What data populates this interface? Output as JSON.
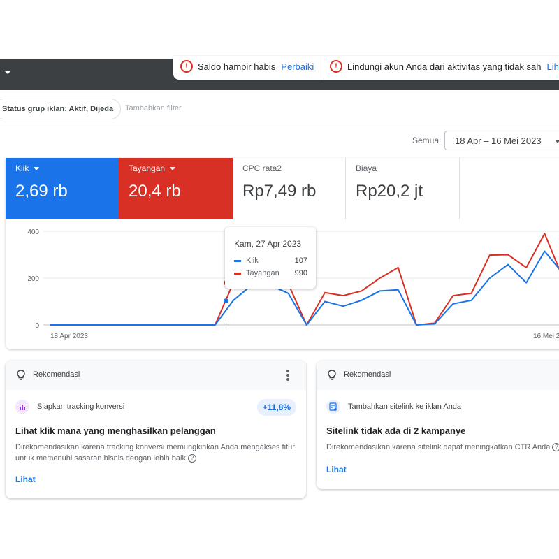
{
  "alerts": [
    {
      "text": "Saldo hampir habis",
      "link": "Perbaiki"
    },
    {
      "text": "Lindungi akun Anda dari aktivitas yang tidak sah",
      "link": "Lih"
    }
  ],
  "filters": {
    "chip": "Status grup iklan: Aktif, Dijeda",
    "add_filter": "Tambahkan filter"
  },
  "date": {
    "prefix": "Semua",
    "range": "18 Apr – 16 Mei 2023"
  },
  "metrics": [
    {
      "label": "Klik",
      "value": "2,69 rb",
      "color": "#1a73e8"
    },
    {
      "label": "Tayangan",
      "value": "20,4 rb",
      "color": "#d93025"
    },
    {
      "label": "CPC rata2",
      "value": "Rp7,49 rb"
    },
    {
      "label": "Biaya",
      "value": "Rp20,2 jt"
    }
  ],
  "tooltip": {
    "title": "Kam, 27 Apr 2023",
    "rows": [
      {
        "name": "Klik",
        "value": "107",
        "color": "#1a73e8"
      },
      {
        "name": "Tayangan",
        "value": "990",
        "color": "#d93025"
      }
    ]
  },
  "chart_data": {
    "type": "line",
    "x_labels": [
      "18 Apr 2023",
      "16 Mei 2023"
    ],
    "yticks": [
      0,
      200,
      400
    ],
    "ylim": [
      0,
      400
    ],
    "grid": true,
    "series": [
      {
        "name": "Klik",
        "color": "#1a73e8",
        "values": [
          0,
          0,
          0,
          0,
          0,
          0,
          0,
          0,
          0,
          0,
          105,
          170,
          170,
          135,
          0,
          100,
          80,
          105,
          145,
          150,
          0,
          5,
          90,
          105,
          200,
          258,
          180,
          315,
          220
        ]
      },
      {
        "name": "Tayangan",
        "color": "#d93025",
        "values": [
          0,
          0,
          0,
          0,
          0,
          0,
          0,
          0,
          0,
          0,
          180,
          230,
          230,
          175,
          0,
          138,
          125,
          145,
          200,
          245,
          0,
          8,
          125,
          135,
          298,
          300,
          245,
          390,
          200
        ]
      }
    ]
  },
  "recommendations": [
    {
      "header": "Rekomendasi",
      "type_label": "Siapkan tracking konversi",
      "badge": "+11,8%",
      "title": "Lihat klik mana yang menghasilkan pelanggan",
      "desc": "Direkomendasikan karena tracking konversi memungkinkan Anda mengakses fitur untuk memenuhi sasaran bisnis dengan lebih baik",
      "action": "Lihat"
    },
    {
      "header": "Rekomendasi",
      "type_label": "Tambahkan sitelink ke iklan Anda",
      "title": "Sitelink tidak ada di 2 kampanye",
      "desc": "Direkomendasikan karena sitelink dapat meningkatkan CTR Anda",
      "action": "Lihat"
    }
  ]
}
